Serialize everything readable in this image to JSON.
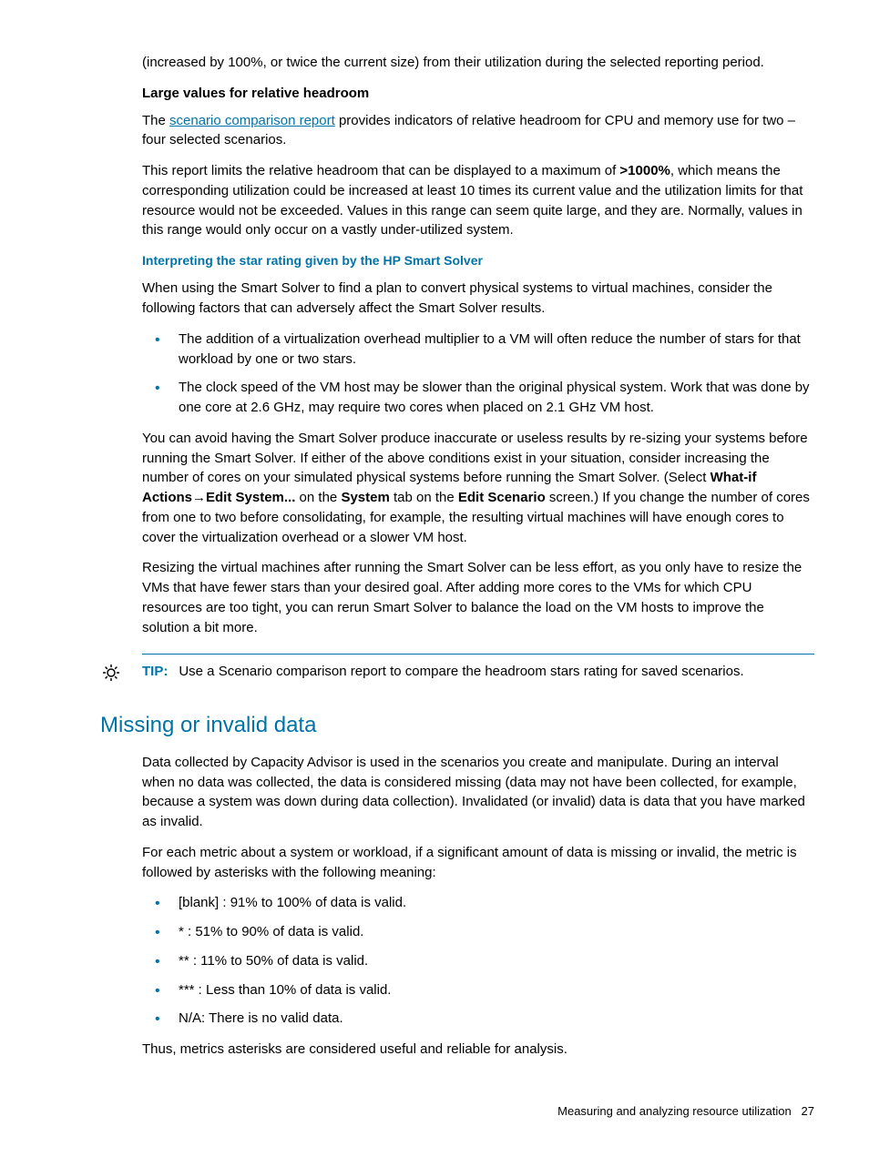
{
  "intro_para": "(increased by 100%, or twice the current size) from their utilization during the selected reporting period.",
  "sub_large_values": "Large values for relative headroom",
  "large_p1a": "The ",
  "scenario_link": "scenario comparison report",
  "large_p1b": " provides indicators of relative headroom for CPU and memory use for two – four selected scenarios.",
  "large_p2a": "This report limits the relative headroom that can be displayed to a maximum of ",
  "large_p2b": ">1000%",
  "large_p2c": ", which means the corresponding utilization could be increased at least 10 times its current value and the utilization limits for that resource would not be exceeded. Values in this range can seem quite large, and they are. Normally, values in this range would only occur on a vastly under-utilized system.",
  "sub_star": "Interpreting the star rating given by the HP Smart Solver",
  "star_p1": "When using the Smart Solver to find a plan to convert physical systems to virtual machines, consider the following factors that can adversely affect the Smart Solver results.",
  "star_bullets": [
    "The addition of a virtualization overhead multiplier to a VM will often reduce the number of stars for that workload by one or two stars.",
    "The clock speed of the VM host may be slower than the original physical system. Work that was done by one core at 2.6 GHz, may require two cores when placed on 2.1 GHz VM host."
  ],
  "star_p2a": "You can avoid having the Smart Solver produce inaccurate or useless results by re-sizing your systems before running the Smart Solver. If either of the above conditions exist in your situation, consider increasing the number of cores on your simulated physical systems before running the Smart Solver. (Select ",
  "star_p2b": "What-if Actions",
  "star_p2c": "→",
  "star_p2d": "Edit System...",
  "star_p2e": " on the ",
  "star_p2f": "System",
  "star_p2g": " tab on the ",
  "star_p2h": "Edit Scenario",
  "star_p2i": " screen.) If you change the number of cores from one to two before consolidating, for example, the resulting virtual machines will have enough cores to cover the virtualization overhead or a slower VM host.",
  "star_p3": "Resizing the virtual machines after running the Smart Solver can be less effort, as you only have to resize the VMs that have fewer stars than your desired goal. After adding more cores to the VMs for which CPU resources are too tight, you can rerun Smart Solver to balance the load on the VM hosts to improve the solution a bit more.",
  "tip_label": "TIP:",
  "tip_text": "Use a Scenario comparison report to compare the headroom stars rating for saved scenarios.",
  "missing_heading": "Missing or invalid data",
  "missing_p1": "Data collected by Capacity Advisor is used in the scenarios you create and manipulate. During an interval when no data was collected, the data is considered missing (data may not have been collected, for example, because a system was down during data collection). Invalidated (or invalid) data is data that you have marked as invalid.",
  "missing_p2": "For each metric about a system or workload, if a significant amount of data is missing or invalid, the metric is followed by asterisks with the following meaning:",
  "missing_bullets": [
    "[blank] : 91% to 100% of data is valid.",
    "* : 51% to 90% of data is valid.",
    "** : 11% to 50% of data is valid.",
    "*** : Less than 10% of data is valid.",
    "N/A: There is no valid data."
  ],
  "missing_p3": "Thus, metrics asterisks are considered useful and reliable for analysis.",
  "footer_text": "Measuring and analyzing resource utilization",
  "page_num": "27"
}
